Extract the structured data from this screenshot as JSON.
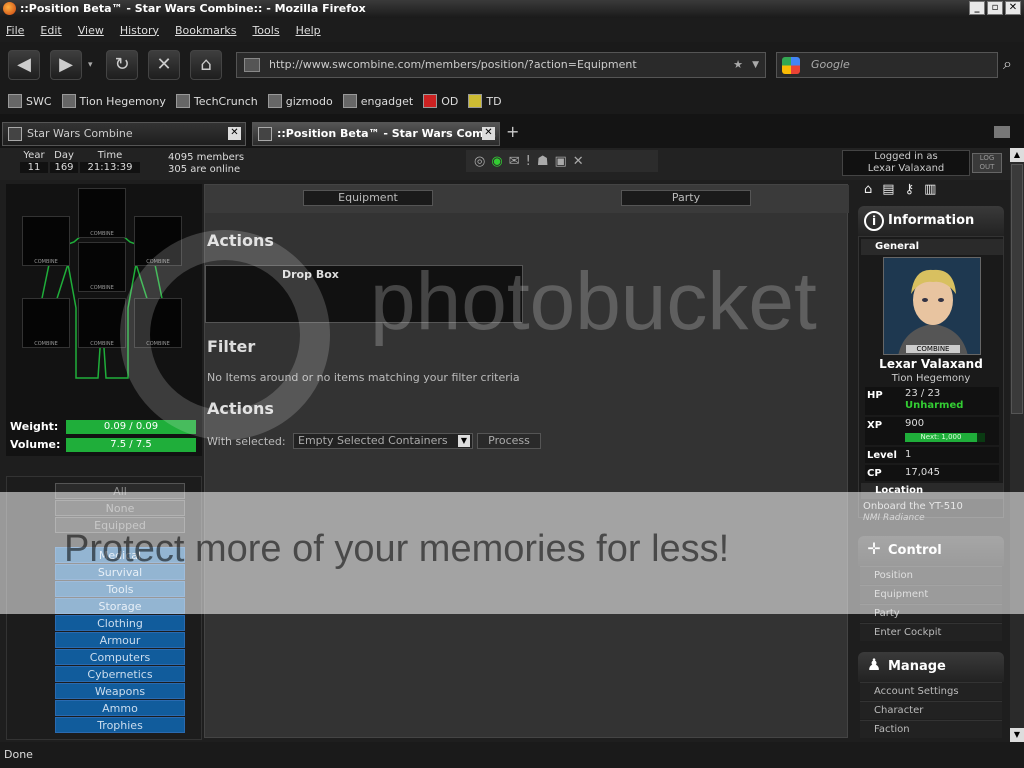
{
  "window": {
    "title": "::Position Beta™ - Star Wars Combine:: - Mozilla Firefox"
  },
  "menu": [
    "File",
    "Edit",
    "View",
    "History",
    "Bookmarks",
    "Tools",
    "Help"
  ],
  "url": "http://www.swcombine.com/members/position/?action=Equipment",
  "search": {
    "placeholder": "Google"
  },
  "bookmarks": [
    "SWC",
    "Tion Hegemony",
    "TechCrunch",
    "gizmodo",
    "engadget",
    "OD",
    "TD"
  ],
  "tabs": [
    {
      "label": "Star Wars Combine"
    },
    {
      "label": "::Position Beta™ - Star Wars Com..."
    }
  ],
  "topbar": {
    "year_label": "Year",
    "year": "11",
    "day_label": "Day",
    "day": "169",
    "time_label": "Time",
    "time": "21:13:39",
    "members": "4095 members",
    "online": "305 are online",
    "logged_label": "Logged in as",
    "user": "Lexar Valaxand",
    "logout": "LOG OUT"
  },
  "equipment": {
    "weight_label": "Weight:",
    "weight": "0.09 / 0.09",
    "volume_label": "Volume:",
    "volume": "7.5 / 7.5",
    "slot_brand": "COMBINE"
  },
  "filters": {
    "gray": [
      "All",
      "None",
      "Equipped"
    ],
    "blue": [
      "Medical",
      "Survival",
      "Tools",
      "Storage",
      "Clothing",
      "Armour",
      "Computers",
      "Cybernetics",
      "Weapons",
      "Ammo",
      "Trophies"
    ]
  },
  "center": {
    "tab_equipment": "Equipment",
    "tab_party": "Party",
    "actions_heading": "Actions",
    "dropbox": "Drop Box",
    "filter_heading": "Filter",
    "filter_msg": "No Items around or no items matching your filter criteria",
    "actions_heading2": "Actions",
    "with_selected": "With selected:",
    "select_value": "Empty Selected Containers",
    "process": "Process"
  },
  "info": {
    "heading": "Information",
    "general": "General",
    "name": "Lexar Valaxand",
    "faction": "Tion Hegemony",
    "hp_label": "HP",
    "hp": "23 / 23",
    "hp_status": "Unharmed",
    "xp_label": "XP",
    "xp": "900",
    "xp_next": "Next: 1,000",
    "xp_fraction": 0.9,
    "level_label": "Level",
    "level": "1",
    "cp_label": "CP",
    "cp": "17,045",
    "location_label": "Location",
    "location": "Onboard the YT-510",
    "ship": "NMI Radiance",
    "portrait_brand": "COMBINE"
  },
  "control": {
    "heading": "Control",
    "items": [
      "Position",
      "Equipment",
      "Party",
      "Enter Cockpit"
    ]
  },
  "manage": {
    "heading": "Manage",
    "items": [
      "Account Settings",
      "Character",
      "Faction"
    ]
  },
  "status": "Done",
  "watermark": {
    "brand": "photobucket",
    "tagline": "Protect more of your memories for less!"
  },
  "colors": {
    "accent_green": "#1fae3a",
    "filter_blue": "#115c9c"
  }
}
